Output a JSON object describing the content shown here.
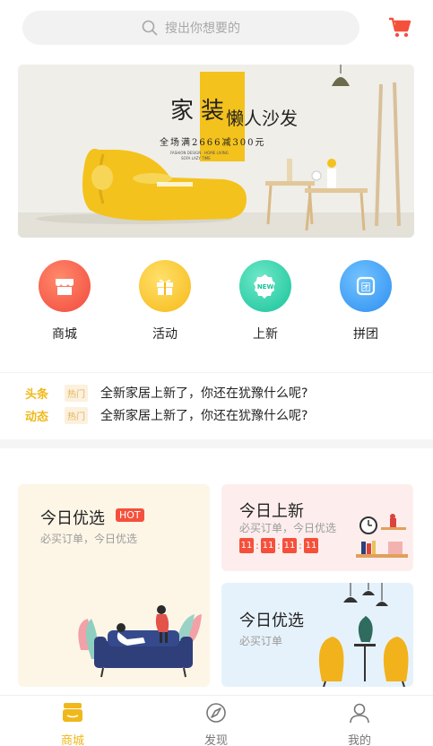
{
  "search": {
    "placeholder": "搜出你想要的"
  },
  "banner": {
    "title_left": "家",
    "title_box": "装",
    "title_right": "懒人沙发",
    "promo_text": "全场满2666减300元",
    "fine_print_1": "FASHION DESIGN · HOME LIVING",
    "fine_print_2": "SOFA LAZY TIME"
  },
  "categories": [
    {
      "label": "商城",
      "icon": "store-icon",
      "color": "#f25a4f"
    },
    {
      "label": "活动",
      "icon": "gift-icon",
      "color": "#f7c52a"
    },
    {
      "label": "上新",
      "icon": "new-badge-icon",
      "color": "#28cfa6"
    },
    {
      "label": "拼团",
      "icon": "group-buy-icon",
      "color": "#3b9ef5"
    }
  ],
  "news": [
    {
      "tag": "头条",
      "badge": "热门",
      "text": "全新家居上新了，你还在犹豫什么呢?"
    },
    {
      "tag": "动态",
      "badge": "热门",
      "text": "全新家居上新了，你还在犹豫什么呢?"
    }
  ],
  "cards": {
    "big": {
      "title": "今日优选",
      "badge": "HOT",
      "subtitle": "必买订单，今日优选"
    },
    "pink": {
      "title": "今日上新",
      "subtitle": "必买订单，今日优选",
      "timer": [
        "11",
        "11",
        "11",
        "11"
      ]
    },
    "blue": {
      "title": "今日优选",
      "subtitle": "必买订单"
    }
  },
  "tabbar": {
    "items": [
      {
        "label": "商城",
        "icon": "store-tab-icon",
        "active": true
      },
      {
        "label": "发现",
        "icon": "discover-icon",
        "active": false
      },
      {
        "label": "我的",
        "icon": "profile-icon",
        "active": false
      }
    ],
    "active_color": "#f0b81a",
    "inactive_color": "#777777"
  },
  "colors": {
    "accent": "#f0b81a",
    "hot": "#f5503b"
  }
}
